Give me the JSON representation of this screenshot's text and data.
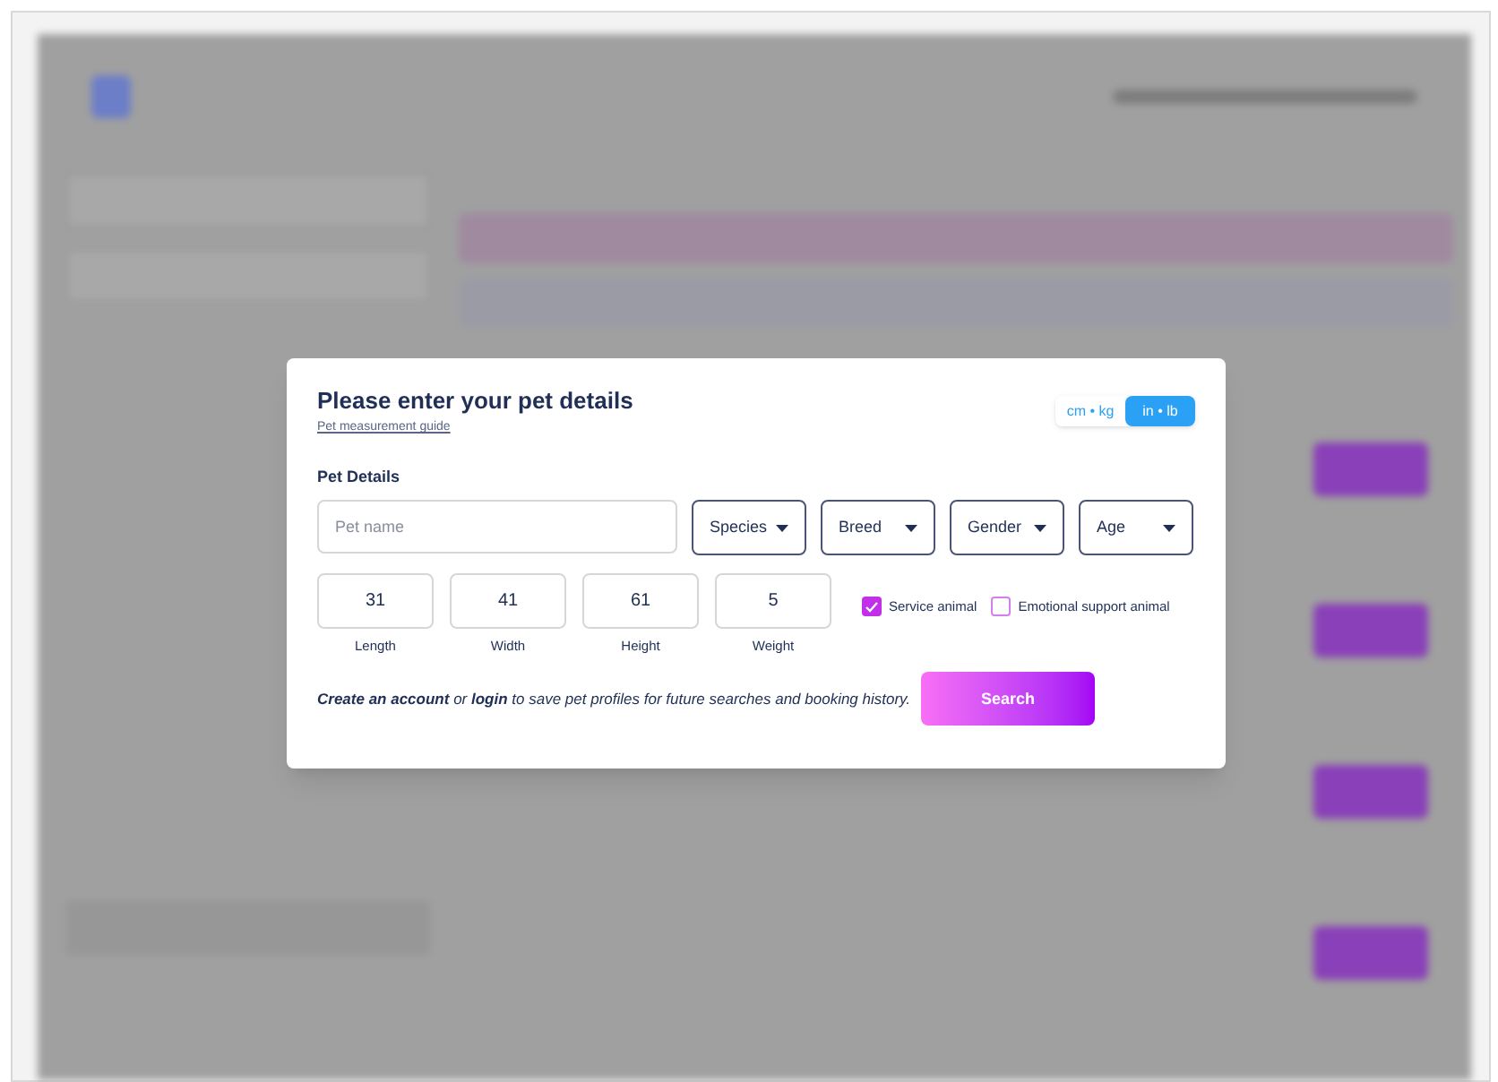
{
  "dialog": {
    "title": "Please enter your pet details",
    "guide_link": "Pet measurement guide",
    "units": [
      {
        "label": "cm • kg",
        "selected": false
      },
      {
        "label": "in • lb",
        "selected": true
      }
    ],
    "section_title": "Pet Details",
    "name_field": {
      "placeholder": "Pet name"
    },
    "dropdowns": [
      "Species",
      "Breed",
      "Gender",
      "Age"
    ],
    "measurements": [
      {
        "value": "31",
        "label": "Length"
      },
      {
        "value": "41",
        "label": "Width"
      },
      {
        "value": "61",
        "label": "Height"
      },
      {
        "value": "5",
        "label": "Weight"
      }
    ],
    "checkboxes": [
      {
        "label": "Service animal",
        "checked": true
      },
      {
        "label": "Emotional support animal",
        "checked": false
      }
    ],
    "footer_note": "**Create an account** or **login** to save pet profiles for future searches and booking history.",
    "search_button": "Search"
  }
}
